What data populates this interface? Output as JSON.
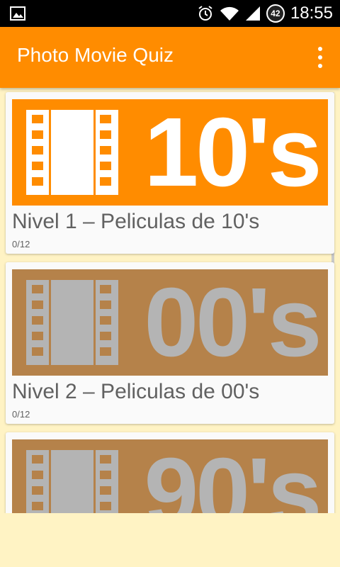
{
  "status_bar": {
    "time": "18:55",
    "battery_level": "42",
    "icons": [
      "image-icon",
      "alarm-icon",
      "wifi-icon",
      "signal-icon",
      "battery-icon"
    ]
  },
  "app_bar": {
    "title": "Photo Movie Quiz",
    "menu_icon": "overflow-menu-icon",
    "color": "#ff8c00"
  },
  "levels": [
    {
      "decade": "10's",
      "title": "Nivel 1 – Peliculas de 10's",
      "progress": "0/12",
      "bg": "#ff8c00",
      "fg": "#ffffff",
      "locked": false
    },
    {
      "decade": "00's",
      "title": "Nivel 2 – Peliculas de 00's",
      "progress": "0/12",
      "bg": "#b5824a",
      "fg": "#b4b4b4",
      "locked": true
    },
    {
      "decade": "90's",
      "title": "",
      "progress": "",
      "bg": "#b5824a",
      "fg": "#b4b4b4",
      "locked": true
    }
  ],
  "colors": {
    "background": "#fff3c4",
    "accent": "#ff8c00",
    "locked_tile": "#b5824a"
  }
}
